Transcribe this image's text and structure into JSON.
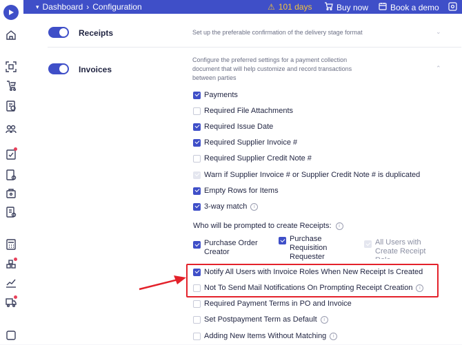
{
  "topbar": {
    "menu_icon": "chevron-down-icon",
    "dashboard_label": "Dashboard",
    "separator": "›",
    "configuration_label": "Configuration",
    "trial_days": "101 days",
    "buy_now": "Buy now",
    "book_demo": "Book a demo",
    "colors": {
      "bar": "#3f4fc8",
      "warning": "#f3c43b"
    }
  },
  "sidebar": {
    "logo": "play-logo",
    "icons": [
      "home-icon",
      "scan-icon",
      "pay-icon",
      "document-cost-icon",
      "group-icon",
      "checklist-icon",
      "invoice-settings-icon",
      "box-icon",
      "receipt-icon",
      "calculator-icon",
      "cubes-icon",
      "chart-icon",
      "truck-icon",
      "more-icon"
    ]
  },
  "sections": {
    "receipts": {
      "title": "Receipts",
      "description": "Set up the preferable confirmation of the delivery stage format",
      "enabled": true
    },
    "invoices": {
      "title": "Invoices",
      "description": "Configure the preferred settings for a payment collection document that will help customize and record transactions between parties",
      "enabled": true
    }
  },
  "options": [
    {
      "label": "Payments",
      "checked": true
    },
    {
      "label": "Required File Attachments",
      "checked": false
    },
    {
      "label": "Required Issue Date",
      "checked": true
    },
    {
      "label": "Required Supplier Invoice #",
      "checked": true
    },
    {
      "label": "Required Supplier Credit Note #",
      "checked": false
    },
    {
      "label": "Warn if Supplier Invoice # or Supplier Credit Note # is duplicated",
      "checked": true,
      "disabled": true
    },
    {
      "label": "Empty Rows for Items",
      "checked": true
    },
    {
      "label": "3-way match",
      "checked": true,
      "info": true
    }
  ],
  "prompt": {
    "question": "Who will be prompted to create Receipts:",
    "choices": [
      {
        "label": "Purchase Order Creator",
        "checked": true
      },
      {
        "label": "Purchase Requisition Requester",
        "checked": true
      },
      {
        "label": "All Users with Create Receipt Role",
        "checked": true,
        "disabled": true
      }
    ]
  },
  "highlighted_options": [
    {
      "label": "Notify All Users with Invoice Roles When New Receipt Is Created",
      "checked": true
    },
    {
      "label": "Not To Send Mail Notifications On Prompting Receipt Creation",
      "checked": false,
      "disabled": true,
      "info": true
    }
  ],
  "more_options": [
    {
      "label": "Required Payment Terms in PO and Invoice",
      "checked": false
    },
    {
      "label": "Set Postpayment Term as Default",
      "checked": false,
      "info": true
    },
    {
      "label": "Adding New Items Without Matching",
      "checked": false,
      "info": true
    }
  ],
  "annotation_colors": {
    "highlight": "#e3212a"
  }
}
